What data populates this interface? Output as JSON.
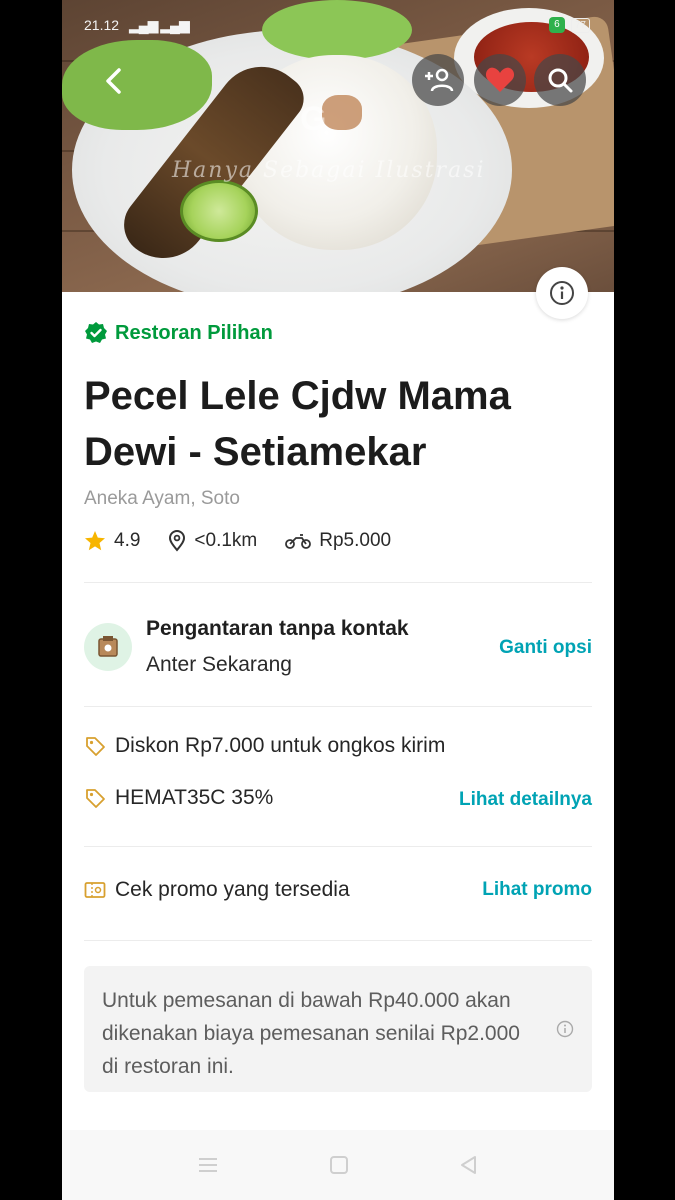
{
  "status_bar": {
    "time": "21.12",
    "signal": "⁴ᴳ",
    "battery": "77"
  },
  "hero": {
    "watermark": "Hanya Sebagai Ilustrasi"
  },
  "badge": {
    "label": "Restoran Pilihan"
  },
  "restaurant": {
    "name": "Pecel Lele Cjdw Mama Dewi - Setiamekar",
    "cuisine": "Aneka Ayam, Soto",
    "rating": "4.9",
    "distance": "<0.1km",
    "delivery_fee": "Rp5.000"
  },
  "delivery": {
    "title": "Pengantaran tanpa kontak",
    "subtitle": "Anter Sekarang",
    "change_label": "Ganti opsi"
  },
  "promos": [
    {
      "text": "Diskon Rp7.000 untuk ongkos kirim"
    },
    {
      "text": "HEMAT35C 35%",
      "link": "Lihat detailnya"
    }
  ],
  "promo_check": {
    "text": "Cek promo yang tersedia",
    "link": "Lihat promo"
  },
  "notice": {
    "text": "Untuk pemesanan di bawah Rp40.000 akan dikenakan biaya pemesanan senilai Rp2.000 di restoran ini."
  },
  "colors": {
    "brand_green": "#009a3c",
    "link_teal": "#00a3b4",
    "star": "#f7b500",
    "heart": "#e8423f"
  }
}
